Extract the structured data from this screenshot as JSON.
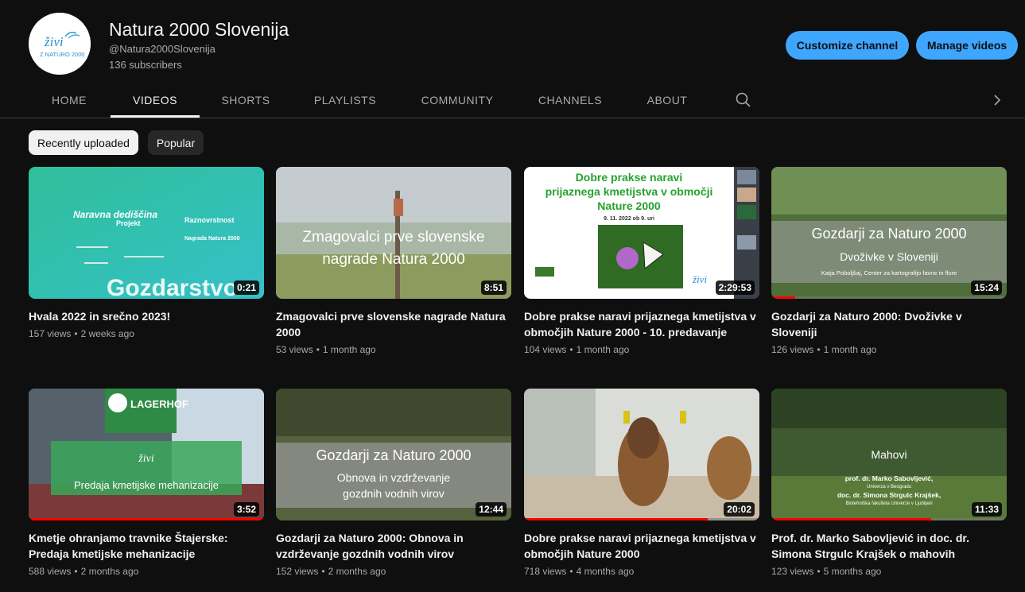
{
  "channel": {
    "name": "Natura 2000 Slovenija",
    "handle": "@Natura2000Slovenija",
    "subscribers": "136 subscribers",
    "logo_text_top": "živi",
    "logo_text_bottom": "Z NATURO 2000"
  },
  "actions": {
    "customize": "Customize channel",
    "manage": "Manage videos"
  },
  "tabs": [
    {
      "label": "HOME"
    },
    {
      "label": "VIDEOS"
    },
    {
      "label": "SHORTS"
    },
    {
      "label": "PLAYLISTS"
    },
    {
      "label": "COMMUNITY"
    },
    {
      "label": "CHANNELS"
    },
    {
      "label": "ABOUT"
    }
  ],
  "active_tab": "VIDEOS",
  "sort": {
    "recent": "Recently uploaded",
    "popular": "Popular"
  },
  "videos": [
    {
      "title": "Hvala 2022 in srečno 2023!",
      "views": "157 views",
      "age": "2 weeks ago",
      "duration": "0:21",
      "progress": 0,
      "thumb_text": [
        "Naravna dediščina",
        "Raznovrstnost",
        "Projekt",
        "Nagrada Natura 2000",
        "Gozdarstvo"
      ]
    },
    {
      "title": "Zmagovalci prve slovenske nagrade Natura 2000",
      "views": "53 views",
      "age": "1 month ago",
      "duration": "8:51",
      "progress": 0,
      "thumb_text": [
        "Zmagovalci prve slovenske",
        "nagrade Natura 2000"
      ]
    },
    {
      "title": "Dobre prakse naravi prijaznega kmetijstva v območjih Nature 2000 - 10. predavanje",
      "views": "104 views",
      "age": "1 month ago",
      "duration": "2:29:53",
      "progress": 0,
      "thumb_text": [
        "Dobre prakse naravi",
        "prijaznega kmetijstva v območji",
        "Nature 2000",
        "9. 11. 2022 ob 9. uri"
      ]
    },
    {
      "title": "Gozdarji za Naturo 2000: Dvoživke v Sloveniji",
      "views": "126 views",
      "age": "1 month ago",
      "duration": "15:24",
      "progress": 0.1,
      "thumb_text": [
        "Gozdarji za Naturo 2000",
        "Dvoživke v Sloveniji",
        "Katja Poboljšaj, Center za kartografijo favne in flore"
      ]
    },
    {
      "title": "Kmetje ohranjamo travnike Štajerske: Predaja kmetijske mehanizacije",
      "views": "588 views",
      "age": "2 months ago",
      "duration": "3:52",
      "progress": 1,
      "thumb_text": [
        "LAGERHOF",
        "Predaja kmetijske mehanizacije"
      ]
    },
    {
      "title": "Gozdarji za Naturo 2000: Obnova in vzdrževanje gozdnih vodnih virov",
      "views": "152 views",
      "age": "2 months ago",
      "duration": "12:44",
      "progress": 0,
      "thumb_text": [
        "Gozdarji za Naturo 2000",
        "Obnova in vzdrževanje",
        "gozdnih vodnih virov"
      ]
    },
    {
      "title": "Dobre prakse naravi prijaznega kmetijstva v območjih Nature 2000",
      "views": "718 views",
      "age": "4 months ago",
      "duration": "20:02",
      "progress": 0.78,
      "thumb_text": []
    },
    {
      "title": "Prof. dr. Marko Sabovljević in doc. dr. Simona Strgulc Krajšek o mahovih",
      "views": "123 views",
      "age": "5 months ago",
      "duration": "11:33",
      "progress": 0.68,
      "thumb_text": [
        "Mahovi",
        "prof. dr. Marko Sabovljević,",
        "Univerza v Beogradu",
        "doc. dr. Simona Strgulc Krajšek,",
        "Biotehniška fakulteta Univerze v Ljubljani"
      ]
    }
  ],
  "colors": {
    "background": "#0f0f0f",
    "accent": "#3ea6ff",
    "progress": "#ff0000"
  },
  "icons": {
    "search": "search-icon",
    "next": "chevron-right-icon"
  }
}
